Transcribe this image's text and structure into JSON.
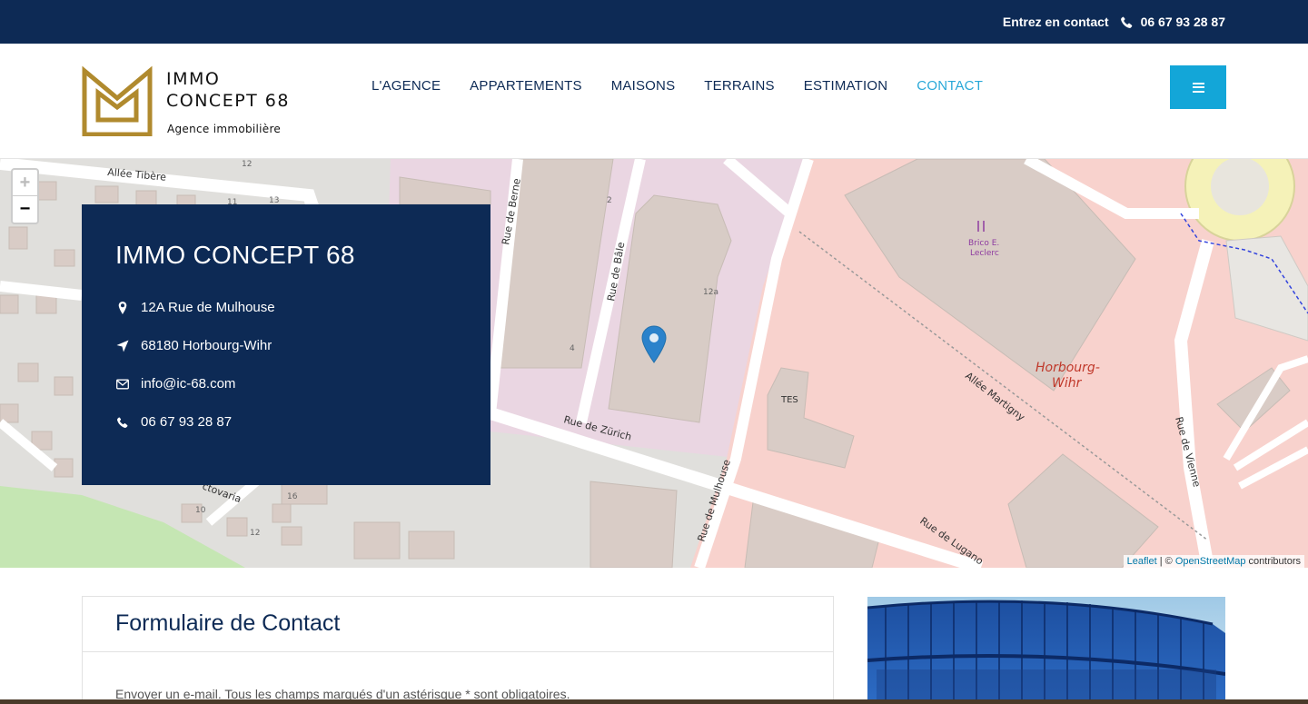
{
  "topbar": {
    "contact_label": "Entrez en contact",
    "phone": "06 67 93 28 87",
    "phone_icon": "phone-icon"
  },
  "header": {
    "logo": {
      "line1": "IMMO",
      "line2": "CONCEPT 68",
      "tagline": "Agence immobilière"
    },
    "nav": [
      {
        "label": "L'AGENCE",
        "active": false
      },
      {
        "label": "APPARTEMENTS",
        "active": false
      },
      {
        "label": "MAISONS",
        "active": false
      },
      {
        "label": "TERRAINS",
        "active": false
      },
      {
        "label": "ESTIMATION",
        "active": false
      },
      {
        "label": "CONTACT",
        "active": true
      }
    ],
    "menu_icon": "hamburger-icon"
  },
  "map": {
    "zoom_in": "+",
    "zoom_out": "−",
    "attribution": {
      "leaflet": "Leaflet",
      "sep": " | © ",
      "osm": "OpenStreetMap",
      "suffix": " contributors"
    },
    "labels": {
      "allee_tibere": "Allée Tibère",
      "rue_de_berne": "Rue de Berne",
      "rue_de_bale": "Rue de Bâle",
      "rue_de_zurich": "Rue de Zürich",
      "rue_de_mulhouse": "Rue de Mulhouse",
      "rue_de_lugano": "Rue de Lugano",
      "rue_de_vienne": "Rue de Vienne",
      "allee_martigny": "Allée Martigny",
      "horbourg": "Horbourg-",
      "wihr": "Wihr",
      "brico1": "Brico E.",
      "brico2": "Leclerc",
      "tes": "TES",
      "num_12a": "12a",
      "num_2": "2",
      "num_4": "4",
      "num_12": "12",
      "num_11": "11",
      "num_13": "13",
      "num_16": "16",
      "num_10": "10",
      "num_12b": "12",
      "octavia": "ctovaria"
    }
  },
  "contact_card": {
    "title": "IMMO CONCEPT 68",
    "rows": [
      {
        "icon": "map-marker-icon",
        "text": "12A Rue de Mulhouse"
      },
      {
        "icon": "location-arrow-icon",
        "text": "68180 Horbourg-Wihr"
      },
      {
        "icon": "envelope-icon",
        "text": "info@ic-68.com"
      },
      {
        "icon": "phone-icon",
        "text": "06 67 93 28 87"
      }
    ]
  },
  "form": {
    "title": "Formulaire de Contact",
    "note": "Envoyer un e-mail. Tous les champs marqués d'un astérisque * sont obligatoires."
  },
  "colors": {
    "navy": "#0d2a55",
    "accent": "#13a6d8",
    "active_nav": "#29a8d8",
    "logo_gold": "#b08a2e"
  }
}
